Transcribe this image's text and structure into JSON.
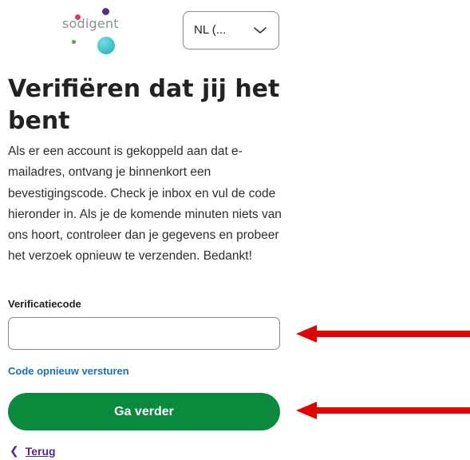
{
  "brand": {
    "logo_text": "sodigent",
    "dot_colors": [
      "#5b2a86",
      "#e0365a",
      "#43b04a",
      "#1fa9b8"
    ]
  },
  "language_select": {
    "value": "NL (...",
    "icon": "chevron-down-icon"
  },
  "page": {
    "title": "Verifiëren dat jij het bent",
    "description": "Als er een account is gekoppeld aan dat e-mailadres, ontvang je binnenkort een bevestigingscode. Check je inbox en vul de code hieronder in. Als je de komende minuten niets van ons hoort, controleer dan je gegevens en probeer het verzoek opnieuw te verzenden. Bedankt!"
  },
  "form": {
    "code_label": "Verificatiecode",
    "code_value": "",
    "resend_label": "Code opnieuw versturen",
    "continue_label": "Ga verder",
    "back_label": "Terug",
    "back_icon": "chevron-left-icon"
  },
  "annotations": {
    "arrow_color": "#e00000",
    "arrow_icon": "arrow-left-icon"
  },
  "colors": {
    "primary_button": "#0a8a3c",
    "link": "#1a6fc2",
    "back_link": "#5b2a86"
  }
}
